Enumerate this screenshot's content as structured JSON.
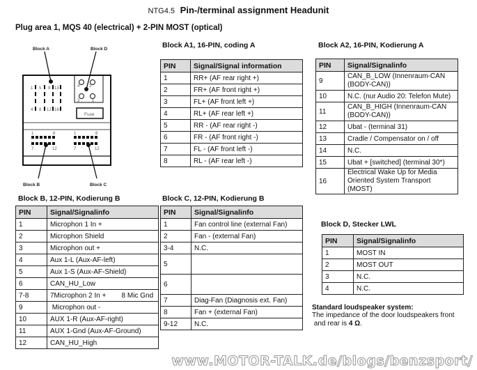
{
  "header": {
    "prefix": "NTG4.5",
    "title": "Pin-/terminal assignment Headunit",
    "subtitle": "Plug area 1, MQS 40 (electrical) + 2-PIN MOST (optical)"
  },
  "diagram": {
    "labels": {
      "block_a": "Block A",
      "block_d": "Block D",
      "block_b": "Block B",
      "block_c": "Block C",
      "fuse": "Fuse"
    },
    "block_a_pins": [
      "1",
      "5",
      "9",
      "13",
      "4",
      "8",
      "12",
      "16"
    ],
    "block_d_pins": [
      "4",
      "2",
      "3",
      "1"
    ],
    "block_bc_pins": [
      "1",
      "6",
      "7",
      "12"
    ]
  },
  "block_a1": {
    "title": "Block A1, 16-PIN, coding A",
    "headers": [
      "PIN",
      "Signal/Signal information"
    ],
    "rows": [
      [
        "1",
        "RR+ (AF rear right +)"
      ],
      [
        "2",
        "FR+ (AF front right +)"
      ],
      [
        "3",
        "FL+ (AF front left +)"
      ],
      [
        "4",
        "RL+ (AF rear left +)"
      ],
      [
        "5",
        "RR - (AF rear right -)"
      ],
      [
        "6",
        "FR - (AF front right -)"
      ],
      [
        "7",
        "FL - (AF front left -)"
      ],
      [
        "8",
        "RL - (AF rear left -)"
      ]
    ]
  },
  "block_a2": {
    "title": "Block A2, 16-PIN, Kodierung A",
    "headers": [
      "PIN",
      "Signal/Signalinfo"
    ],
    "rows": [
      [
        "9",
        "CAN_B_LOW (Innenraum-CAN (BODY-CAN))"
      ],
      [
        "10",
        "N.C. (nur Audio 20: Telefon Mute)"
      ],
      [
        "11",
        "CAN_B_HIGH (Innenraum-CAN (BODY-CAN))"
      ],
      [
        "12",
        "Ubat - (terminal 31)"
      ],
      [
        "13",
        "Cradle / Compensator on / off"
      ],
      [
        "14",
        "N.C."
      ],
      [
        "15",
        "Ubat + [switched] (terminal 30*)"
      ],
      [
        "16",
        "Electrical Wake Up for Media Oriented System Transport (MOST)"
      ]
    ]
  },
  "block_b": {
    "title": "Block B, 12-PIN, Kodierung B",
    "headers": [
      "PIN",
      "Signal/Signalinfo"
    ],
    "rows": [
      [
        "1",
        "Microphon 1 In +"
      ],
      [
        "2",
        "Microphon Shield"
      ],
      [
        "3",
        "Microphon out +"
      ],
      [
        "4",
        "Aux 1-L (Aux-AF-left)"
      ],
      [
        "5",
        "Aux 1-S (Aux-AF-Shield)"
      ],
      [
        "6",
        "CAN_HU_Low"
      ],
      [
        "7-8",
        "7Microphon 2 In +        8 Mic Gnd"
      ],
      [
        "9",
        " Microphon out -"
      ],
      [
        "10",
        "AUX 1-R (Aux-AF-right)"
      ],
      [
        "11",
        "AUX 1-Gnd (Aux-AF-Ground)"
      ],
      [
        "12",
        "CAN_HU_High"
      ]
    ]
  },
  "block_c": {
    "title": "Block C, 12-PIN, Kodierung B",
    "headers": [
      "PIN",
      "Signal/Signalinfo"
    ],
    "rows": [
      [
        "1",
        "Fan control line (external Fan)"
      ],
      [
        "2",
        "Fan - (external Fan)"
      ],
      [
        "3-4",
        "N.C."
      ],
      [
        "5",
        ""
      ],
      [
        "6",
        ""
      ],
      [
        "7",
        "Diag-Fan (Diagnosis ext. Fan)"
      ],
      [
        "8",
        "Fan + (external Fan)"
      ],
      [
        "9-12",
        "N.C."
      ]
    ]
  },
  "block_d": {
    "title": "Block D, Stecker LWL",
    "headers": [
      "PIN",
      "Signal/Signalinfo"
    ],
    "rows": [
      [
        "1",
        "MOST IN"
      ],
      [
        "2",
        "MOST OUT"
      ],
      [
        "3",
        "N.C."
      ],
      [
        "4",
        "N.C."
      ]
    ]
  },
  "note": {
    "heading": "Standard loudspeaker system:",
    "line1": "The impedance of the door loudspeakers front",
    "line2_prefix": " and rear is ",
    "line2_value": "4 Ω",
    "line2_suffix": "."
  },
  "watermark": "www.MOTOR-TALK.de/blogs/benzsport/"
}
